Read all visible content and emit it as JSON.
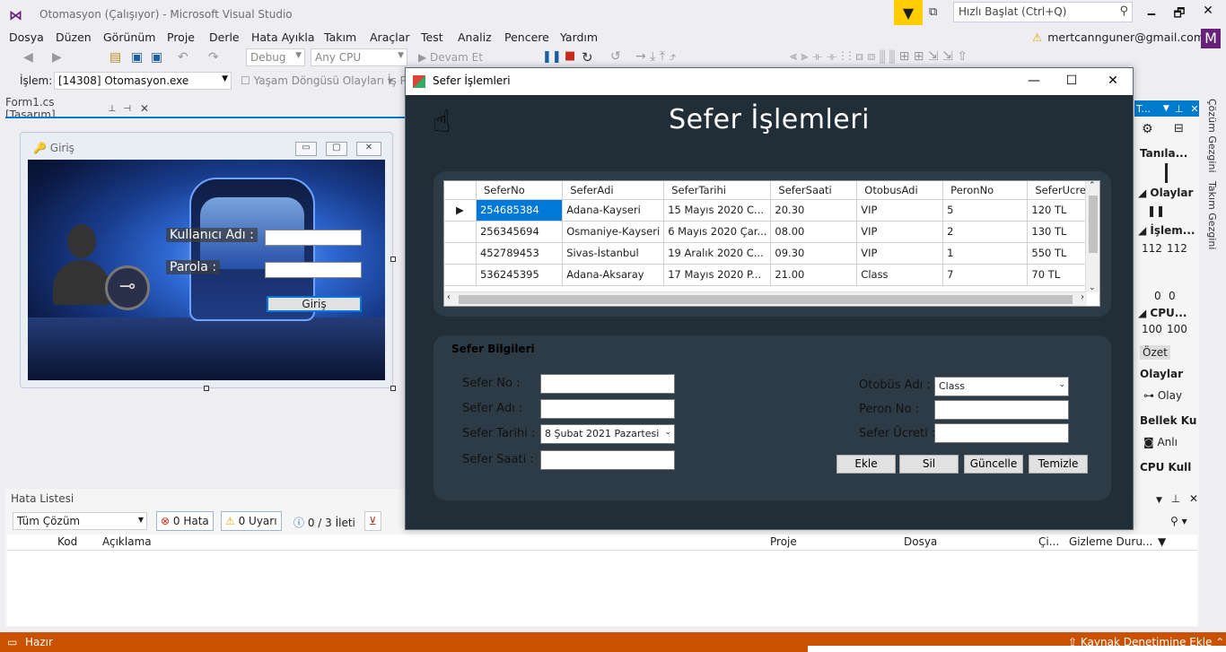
{
  "window": {
    "title": "Otomasyon (Çalışıyor) - Microsoft Visual Studio",
    "quick_launch_placeholder": "Hızlı Başlat (Ctrl+Q)",
    "min": "🗕",
    "max": "🗗",
    "close": "✕"
  },
  "menu": [
    "Dosya",
    "Düzen",
    "Görünüm",
    "Proje",
    "Derle",
    "Hata Ayıkla",
    "Takım",
    "Araçlar",
    "Test",
    "Analiz",
    "Pencere",
    "Yardım"
  ],
  "account": {
    "email": "mertcannguner@gmail.com",
    "avatar": "M"
  },
  "toolbar": {
    "config": "Debug",
    "platform": "Any CPU",
    "continue": "Devam Et",
    "process_label": "İşlem:",
    "process": "[14308] Otomasyon.exe",
    "lifecycle": "Yaşam Döngüsü Olayları",
    "thread": "İş P"
  },
  "designer": {
    "tab": "Form1.cs [Tasarım]",
    "form_title": "Giriş",
    "username_label": "Kullanıcı Adı :",
    "password_label": "Parola :",
    "login_button": "Giriş"
  },
  "right_panel": {
    "header": "T...",
    "diag": "Tanıla...",
    "events": "Olaylar",
    "process": "İşlem...",
    "v1": "112",
    "v2": "112",
    "z1": "0",
    "z2": "0",
    "cpu": "CPU...",
    "c1": "100",
    "c2": "100",
    "summary": "Özet",
    "events2": "Olaylar",
    "events3": "Olay",
    "memory": "Bellek Ku",
    "take": "Anlı",
    "cpuuse": "CPU Kull",
    "vtab1": "Çözüm Gezgini",
    "vtab2": "Takım Gezgini"
  },
  "error_list": {
    "title": "Hata Listesi",
    "scope": "Tüm Çözüm",
    "errors": "0 Hata",
    "warnings": "0 Uyarı",
    "messages": "0 / 3 İleti",
    "columns": [
      "Kod",
      "Açıklama",
      "Proje",
      "Dosya",
      "Çi...",
      "Gizleme Duru..."
    ]
  },
  "status": {
    "left": "Hazır",
    "right": "Kaynak Denetimine Ekle"
  },
  "sefer_dialog": {
    "title": "Sefer İşlemleri",
    "heading": "Sefer İşlemleri",
    "grid": {
      "columns": [
        "SeferNo",
        "SeferAdi",
        "SeferTarihi",
        "SeferSaati",
        "OtobusAdi",
        "PeronNo",
        "SeferUcreti"
      ],
      "rows": [
        [
          "254685384",
          "Adana-Kayseri",
          "15 Mayıs 2020 C...",
          "20.30",
          "VIP",
          "5",
          "120 TL"
        ],
        [
          "256345694",
          "Osmaniye-Kayseri",
          "6 Mayıs 2020 Çar...",
          "08.00",
          "VIP",
          "2",
          "130 TL"
        ],
        [
          "452789453",
          "Sivas-İstanbul",
          "19 Aralık 2020 C...",
          "09.30",
          "VIP",
          "1",
          "550 TL"
        ],
        [
          "536245395",
          "Adana-Aksaray",
          "17 Mayıs 2020 P...",
          "21.00",
          "Class",
          "7",
          "70 TL"
        ]
      ]
    },
    "info": {
      "title": "Sefer Bilgileri",
      "sefer_no": "Sefer No :",
      "sefer_adi": "Sefer Adı :",
      "sefer_tarihi": "Sefer Tarihi :",
      "sefer_saati": "Sefer Saati :",
      "otobus_adi": "Otobüs Adı :",
      "peron_no": "Peron No :",
      "sefer_ucreti": "Sefer Ücreti :",
      "date_value": "8   Şubat    2021  Pazartesi",
      "otobus_value": "Class"
    },
    "buttons": {
      "add": "Ekle",
      "delete": "Sil",
      "update": "Güncelle",
      "clear": "Temizle"
    }
  }
}
